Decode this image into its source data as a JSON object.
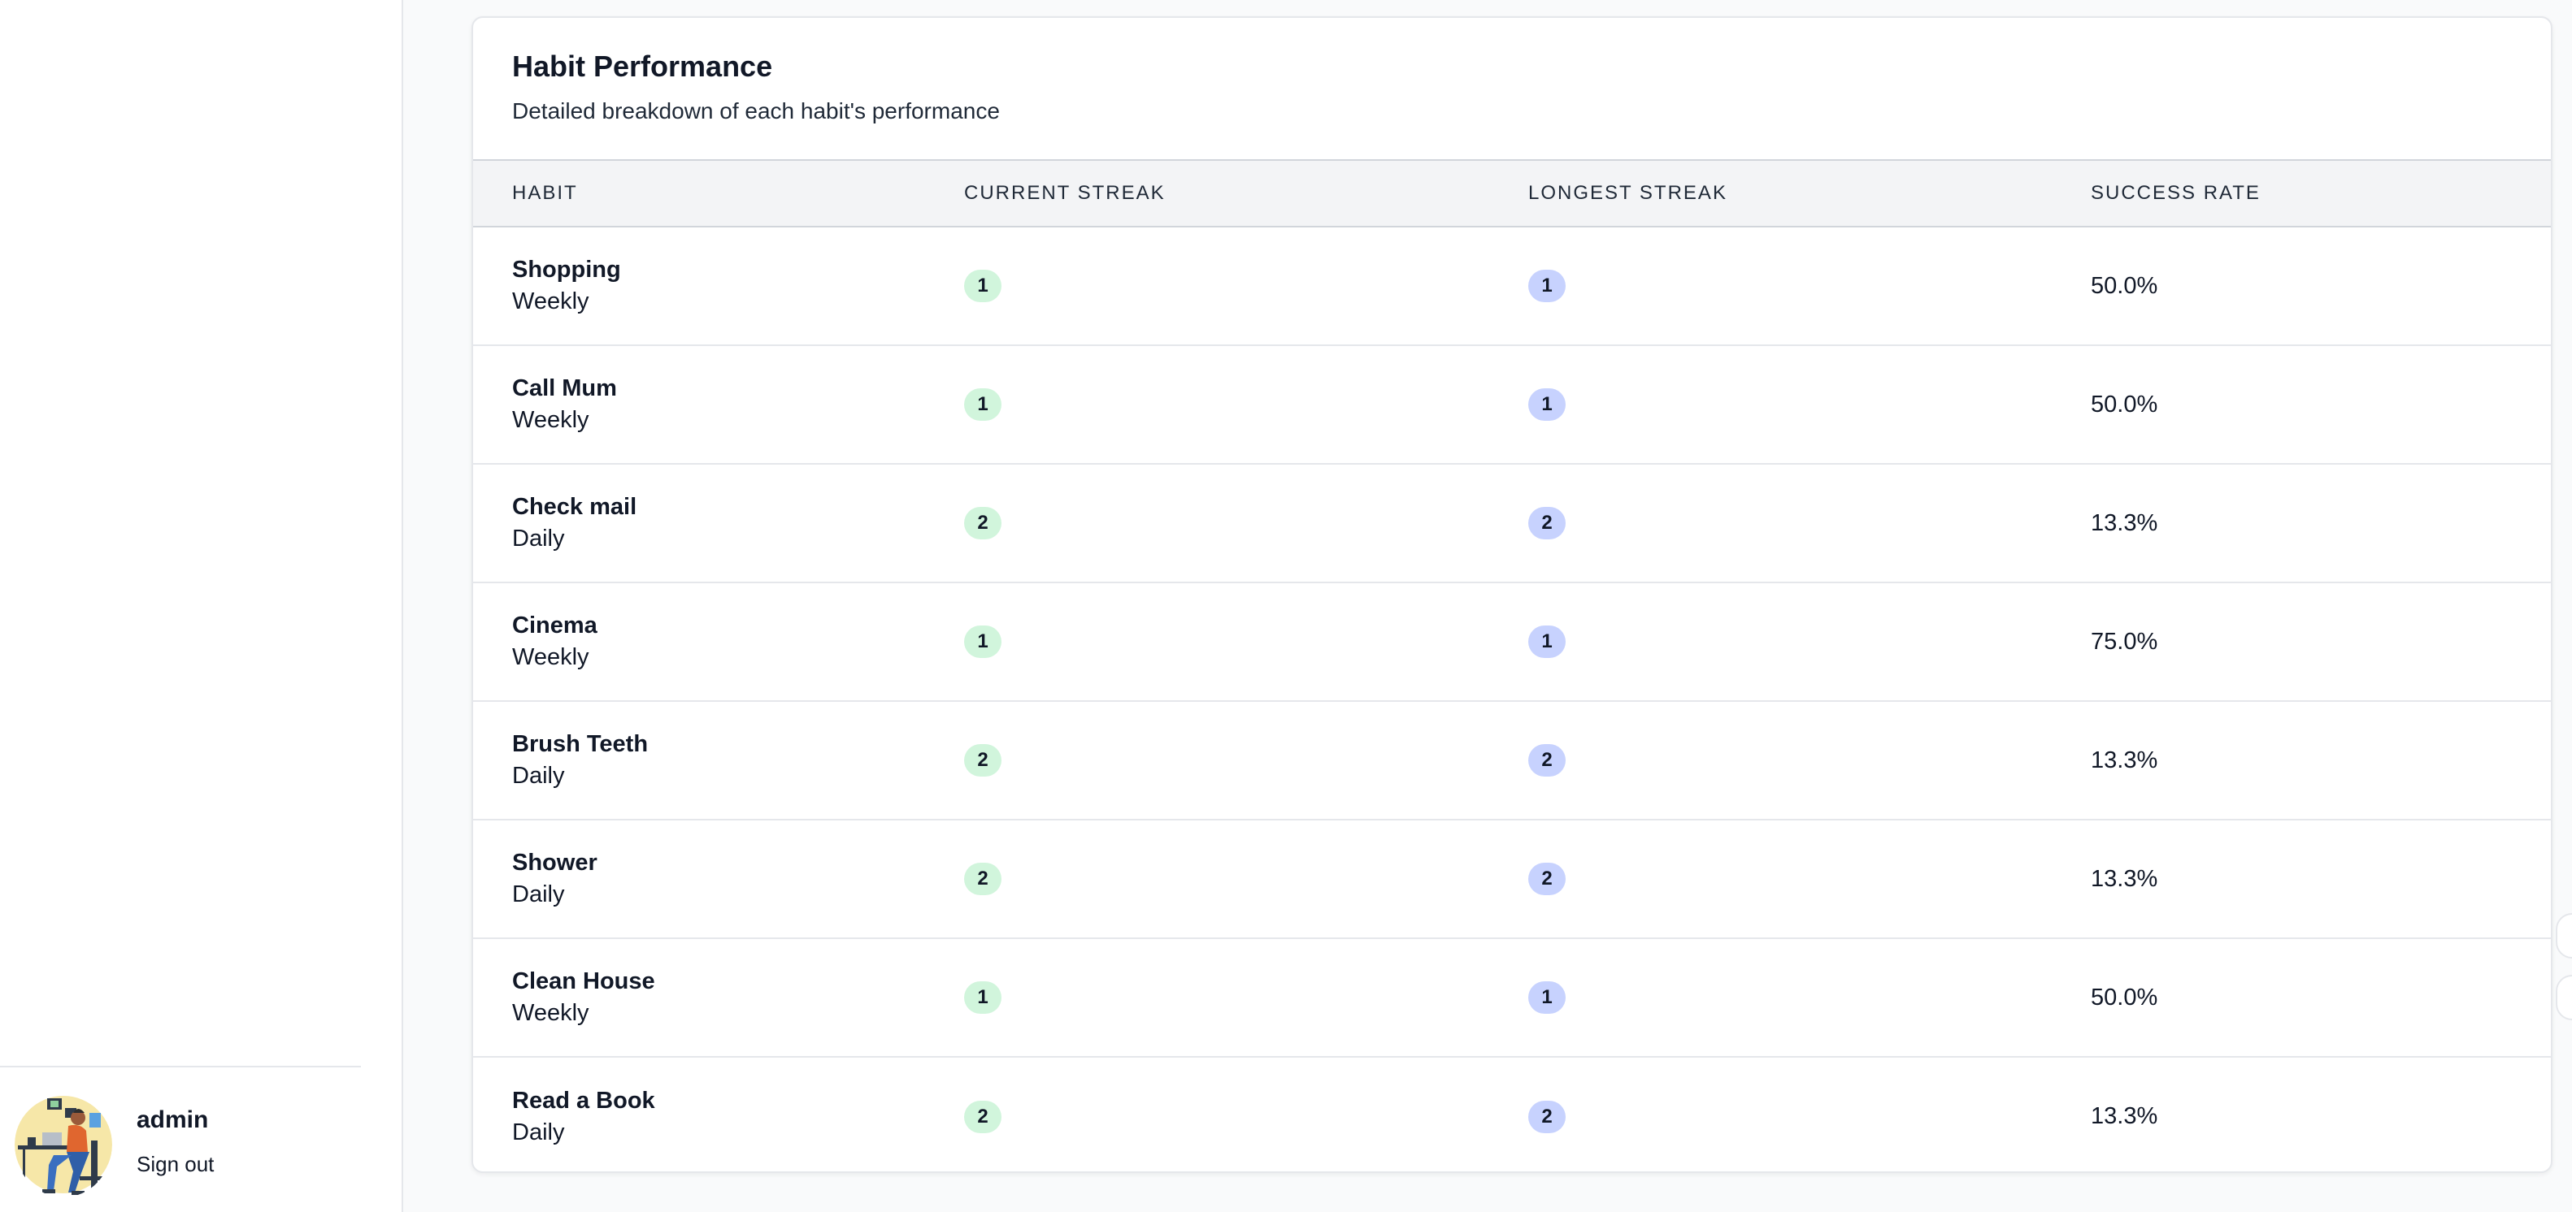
{
  "user": {
    "name": "admin",
    "sign_out_label": "Sign out"
  },
  "performance": {
    "title": "Habit Performance",
    "subtitle": "Detailed breakdown of each habit's performance",
    "columns": {
      "habit": "HABIT",
      "current_streak": "CURRENT STREAK",
      "longest_streak": "LONGEST STREAK",
      "success_rate": "SUCCESS RATE"
    },
    "rows": [
      {
        "name": "Shopping",
        "frequency": "Weekly",
        "current": "1",
        "longest": "1",
        "rate": "50.0%"
      },
      {
        "name": "Call Mum",
        "frequency": "Weekly",
        "current": "1",
        "longest": "1",
        "rate": "50.0%"
      },
      {
        "name": "Check mail",
        "frequency": "Daily",
        "current": "2",
        "longest": "2",
        "rate": "13.3%"
      },
      {
        "name": "Cinema",
        "frequency": "Weekly",
        "current": "1",
        "longest": "1",
        "rate": "75.0%"
      },
      {
        "name": "Brush Teeth",
        "frequency": "Daily",
        "current": "2",
        "longest": "2",
        "rate": "13.3%"
      },
      {
        "name": "Shower",
        "frequency": "Daily",
        "current": "2",
        "longest": "2",
        "rate": "13.3%"
      },
      {
        "name": "Clean House",
        "frequency": "Weekly",
        "current": "1",
        "longest": "1",
        "rate": "50.0%"
      },
      {
        "name": "Read a Book",
        "frequency": "Daily",
        "current": "2",
        "longest": "2",
        "rate": "13.3%"
      }
    ]
  },
  "colors": {
    "current_badge": "#d1f5dc",
    "longest_badge": "#c7d2fe",
    "header_bg": "#f3f4f6"
  }
}
